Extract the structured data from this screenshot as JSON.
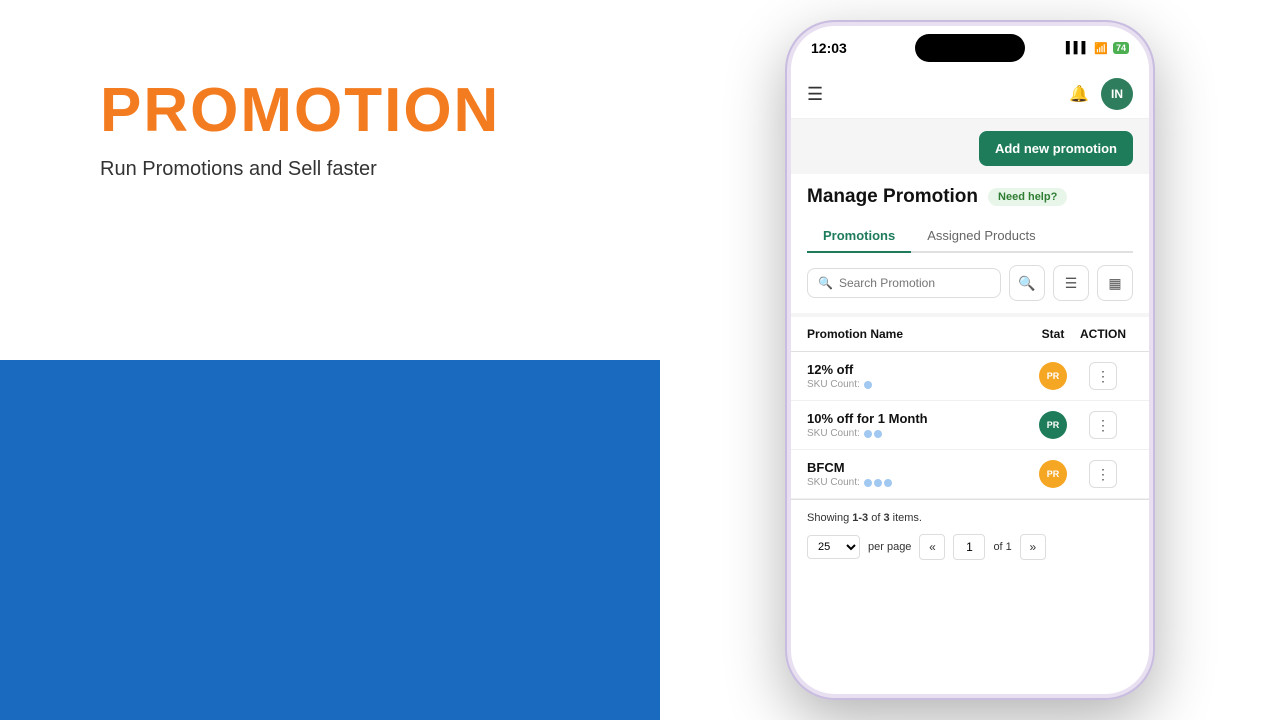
{
  "left": {
    "title": "PROMOTION",
    "subtitle": "Run Promotions and Sell faster"
  },
  "phone": {
    "status_bar": {
      "time": "12:03",
      "battery": "74",
      "signal": "▌▌▌",
      "wifi": "WiFi"
    },
    "header": {
      "user_initials": "IN"
    },
    "add_button_label": "Add new promotion",
    "manage_title": "Manage Promotion",
    "need_help_label": "Need help?",
    "tabs": [
      {
        "label": "Promotions",
        "active": true
      },
      {
        "label": "Assigned Products",
        "active": false
      }
    ],
    "search_placeholder": "Search Promotion",
    "table": {
      "columns": {
        "name": "Promotion Name",
        "status": "Stat",
        "action": "ACTION"
      },
      "rows": [
        {
          "name": "12% off",
          "sku_label": "SKU Count:",
          "sku_count": "",
          "status_badge": "PR",
          "status_color": "orange"
        },
        {
          "name": "10% off for 1 Month",
          "sku_label": "SKU Count:",
          "sku_count": "",
          "status_badge": "PR",
          "status_color": "green"
        },
        {
          "name": "BFCM",
          "sku_label": "SKU Count:",
          "sku_count": "",
          "status_badge": "PR",
          "status_color": "orange"
        }
      ]
    },
    "pagination": {
      "showing_text_pre": "Showing ",
      "showing_range": "1-3",
      "showing_of": " of ",
      "showing_total": "3",
      "showing_text_post": " items.",
      "per_page": "25",
      "per_page_label": "per page",
      "current_page": "1",
      "total_pages": "1",
      "nav_prev": "«",
      "nav_next": "»"
    }
  }
}
